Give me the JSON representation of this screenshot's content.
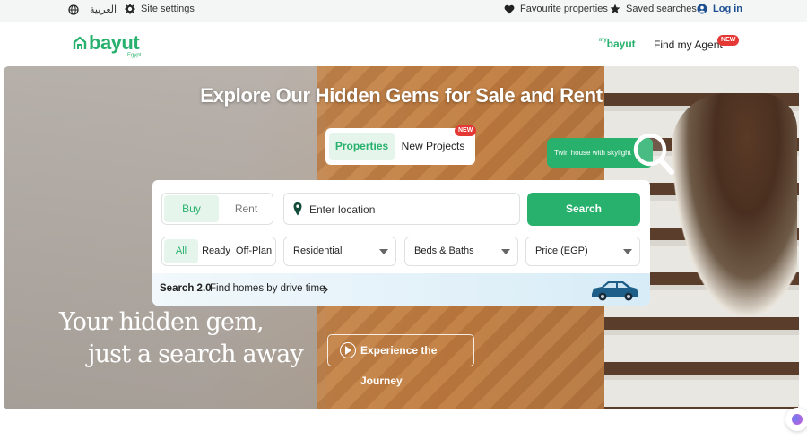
{
  "topbar": {
    "language": "العربية",
    "site_settings": "Site settings",
    "favourites": "Favourite properties",
    "saved_searches": "Saved searches",
    "login": "Log in"
  },
  "header": {
    "logo": "bayut",
    "logo_sub": "Egypt",
    "mybayut": "bayut",
    "mybayut_prefix": "my",
    "find_agent": "Find my Agent",
    "new_badge": "NEW"
  },
  "hero": {
    "title": "Explore Our Hidden Gems for Sale and Rent",
    "tabs": [
      {
        "label": "Properties",
        "active": true
      },
      {
        "label": "New Projects",
        "active": false
      }
    ],
    "tab_new_badge": "NEW",
    "pill_label": "Twin house with skylight",
    "tagline_line1": "Your hidden gem,",
    "tagline_line2": "just a search away",
    "journey_button": "Experience the Journey"
  },
  "search": {
    "purpose": [
      "Buy",
      "Rent"
    ],
    "selected_purpose": "Buy",
    "location_placeholder": "Enter location",
    "search_button": "Search",
    "completion": [
      "All",
      "Ready",
      "Off-Plan"
    ],
    "selected_completion": "All",
    "property_type": "Residential",
    "beds_baths": "Beds & Baths",
    "price": "Price (EGP)",
    "search2_title": "Search 2.0",
    "search2_text": "Find homes by drive time"
  },
  "colors": {
    "brand_green": "#28b16d",
    "login_blue": "#1d4f91",
    "badge_red": "#e53935"
  },
  "icons": [
    "globe-icon",
    "gear-icon",
    "heart-icon",
    "star-icon",
    "user-icon",
    "location-pin-icon",
    "chevron-right-icon",
    "car-icon",
    "play-icon",
    "magnifier-icon",
    "caret-down-icon"
  ]
}
